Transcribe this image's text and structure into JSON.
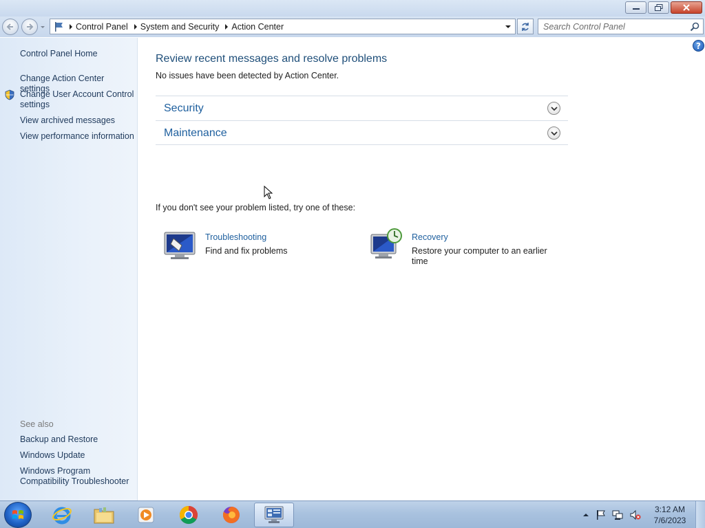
{
  "window": {
    "controls": {
      "minimize": "minimize",
      "maximize": "restore",
      "close": "close"
    }
  },
  "address": {
    "crumbs": [
      "Control Panel",
      "System and Security",
      "Action Center"
    ],
    "search_placeholder": "Search Control Panel"
  },
  "sidebar": {
    "items": [
      {
        "label": "Control Panel Home"
      },
      {
        "label": "Change Action Center settings"
      },
      {
        "label": "Change User Account Control settings"
      },
      {
        "label": "View archived messages"
      },
      {
        "label": "View performance information"
      }
    ],
    "see_also_label": "See also",
    "see_also": [
      {
        "label": "Backup and Restore"
      },
      {
        "label": "Windows Update"
      },
      {
        "label": "Windows Program Compatibility Troubleshooter"
      }
    ]
  },
  "main": {
    "title": "Review recent messages and resolve problems",
    "subtitle": "No issues have been detected by Action Center.",
    "sections": [
      {
        "label": "Security"
      },
      {
        "label": "Maintenance"
      }
    ],
    "hint": "If you don't see your problem listed, try one of these:",
    "tools": [
      {
        "title": "Troubleshooting",
        "desc": "Find and fix problems",
        "icon": "troubleshooting-icon"
      },
      {
        "title": "Recovery",
        "desc": "Restore your computer to an earlier time",
        "icon": "recovery-icon"
      }
    ]
  },
  "taskbar": {
    "apps": [
      "internet-explorer-icon",
      "file-explorer-icon",
      "media-player-icon",
      "chrome-icon",
      "firefox-icon",
      "control-panel-icon"
    ],
    "clock_time": "3:12 AM",
    "clock_date": "7/6/2023"
  },
  "colors": {
    "link": "#1e5f9e",
    "title": "#1e4e79",
    "sidebar": "#e4eef9"
  }
}
